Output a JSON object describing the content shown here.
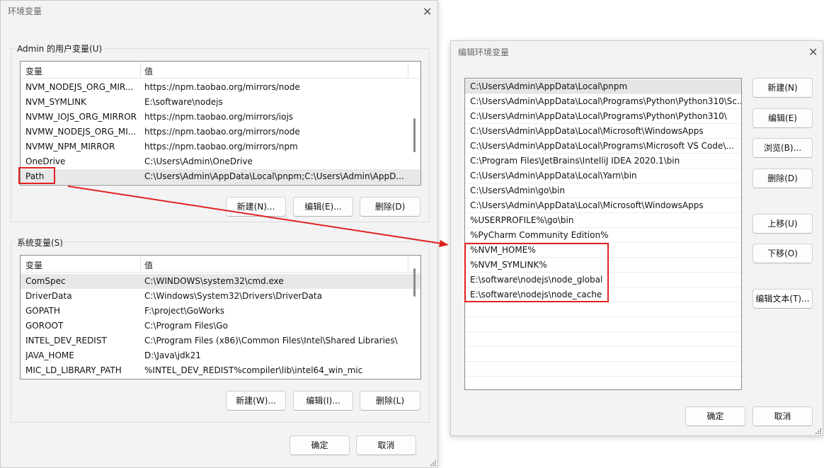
{
  "env_dialog": {
    "title": "环境变量",
    "user_group_label": "Admin 的用户变量(U)",
    "system_group_label": "系统变量(S)",
    "col_variable": "变量",
    "col_value": "值",
    "user_rows": [
      {
        "name": "NVM_NODEJS_ORG_MIR...",
        "value": "https://npm.taobao.org/mirrors/node"
      },
      {
        "name": "NVM_SYMLINK",
        "value": "E:\\software\\nodejs"
      },
      {
        "name": "NVMW_IOJS_ORG_MIRROR",
        "value": "https://npm.taobao.org/mirrors/iojs"
      },
      {
        "name": "NVMW_NODEJS_ORG_MI...",
        "value": "https://npm.taobao.org/mirrors/node"
      },
      {
        "name": "NVMW_NPM_MIRROR",
        "value": "https://npm.taobao.org/mirrors/npm"
      },
      {
        "name": "OneDrive",
        "value": "C:\\Users\\Admin\\OneDrive"
      },
      {
        "name": "Path",
        "value": "C:\\Users\\Admin\\AppData\\Local\\pnpm;C:\\Users\\Admin\\AppD..."
      }
    ],
    "system_rows": [
      {
        "name": "ComSpec",
        "value": "C:\\WINDOWS\\system32\\cmd.exe"
      },
      {
        "name": "DriverData",
        "value": "C:\\Windows\\System32\\Drivers\\DriverData"
      },
      {
        "name": "GOPATH",
        "value": "F:\\project\\GoWorks"
      },
      {
        "name": "GOROOT",
        "value": "C:\\Program Files\\Go"
      },
      {
        "name": "INTEL_DEV_REDIST",
        "value": "C:\\Program Files (x86)\\Common Files\\Intel\\Shared Libraries\\"
      },
      {
        "name": "JAVA_HOME",
        "value": "D:\\Java\\jdk21"
      },
      {
        "name": "MIC_LD_LIBRARY_PATH",
        "value": "%INTEL_DEV_REDIST%compiler\\lib\\intel64_win_mic"
      }
    ],
    "user_buttons": {
      "new": "新建(N)...",
      "edit": "编辑(E)...",
      "delete": "删除(D)"
    },
    "system_buttons": {
      "new": "新建(W)...",
      "edit": "编辑(I)...",
      "delete": "删除(L)"
    },
    "ok": "确定",
    "cancel": "取消"
  },
  "edit_dialog": {
    "title": "编辑环境变量",
    "paths": [
      "C:\\Users\\Admin\\AppData\\Local\\pnpm",
      "C:\\Users\\Admin\\AppData\\Local\\Programs\\Python\\Python310\\Sc...",
      "C:\\Users\\Admin\\AppData\\Local\\Programs\\Python\\Python310\\",
      "C:\\Users\\Admin\\AppData\\Local\\Microsoft\\WindowsApps",
      "C:\\Users\\Admin\\AppData\\Local\\Programs\\Microsoft VS Code\\...",
      "C:\\Program Files\\JetBrains\\IntelliJ IDEA 2020.1\\bin",
      "C:\\Users\\Admin\\AppData\\Local\\Yarn\\bin",
      "C:\\Users\\Admin\\go\\bin",
      "C:\\Users\\Admin\\AppData\\Local\\Microsoft\\WindowsApps",
      "%USERPROFILE%\\go\\bin",
      "%PyCharm Community Edition%",
      "%NVM_HOME%",
      "%NVM_SYMLINK%",
      "E:\\software\\nodejs\\node_global",
      "E:\\software\\nodejs\\node_cache"
    ],
    "buttons": {
      "new": "新建(N)",
      "edit": "编辑(E)",
      "browse": "浏览(B)...",
      "delete": "删除(D)",
      "move_up": "上移(U)",
      "move_down": "下移(O)",
      "edit_text": "编辑文本(T)..."
    },
    "ok": "确定",
    "cancel": "取消"
  },
  "colors": {
    "annotation": "#e02020",
    "dialog_bg": "#f3f3f3",
    "selected_row": "#e8e8e8"
  }
}
